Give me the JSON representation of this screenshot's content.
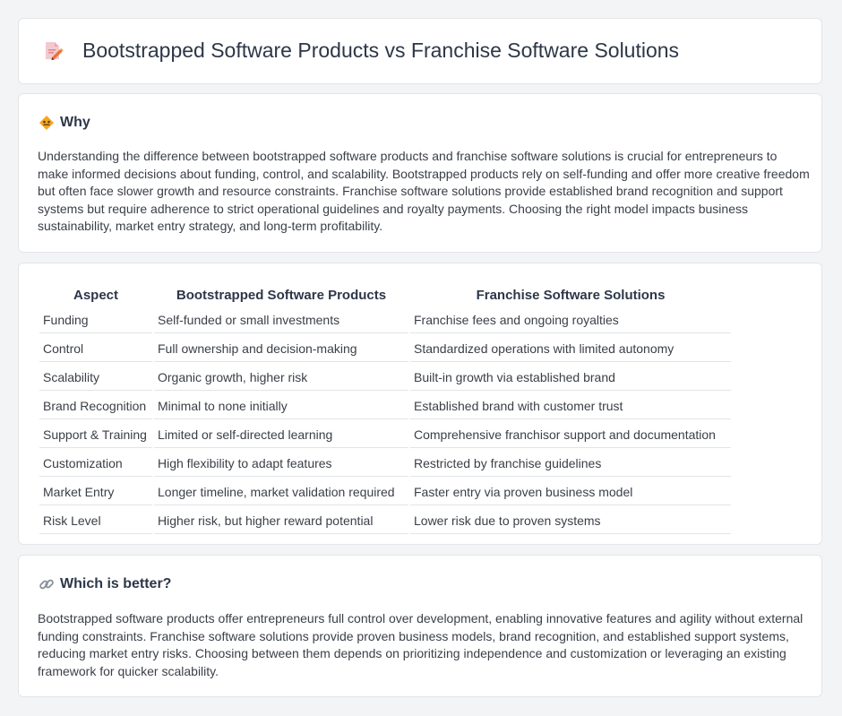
{
  "page": {
    "title": "Bootstrapped Software Products vs Franchise Software Solutions",
    "title_icon": "document-pencil-icon"
  },
  "why": {
    "heading": "Why",
    "icon": "diamond-warning-icon",
    "text": "Understanding the difference between bootstrapped software products and franchise software solutions is crucial for entrepreneurs to make informed decisions about funding, control, and scalability. Bootstrapped products rely on self-funding and offer more creative freedom but often face slower growth and resource constraints. Franchise software solutions provide established brand recognition and support systems but require adherence to strict operational guidelines and royalty payments. Choosing the right model impacts business sustainability, market entry strategy, and long-term profitability."
  },
  "table": {
    "headers": [
      "Aspect",
      "Bootstrapped Software Products",
      "Franchise Software Solutions"
    ],
    "rows": [
      [
        "Funding",
        "Self-funded or small investments",
        "Franchise fees and ongoing royalties"
      ],
      [
        "Control",
        "Full ownership and decision-making",
        "Standardized operations with limited autonomy"
      ],
      [
        "Scalability",
        "Organic growth, higher risk",
        "Built-in growth via established brand"
      ],
      [
        "Brand Recognition",
        "Minimal to none initially",
        "Established brand with customer trust"
      ],
      [
        "Support & Training",
        "Limited or self-directed learning",
        "Comprehensive franchisor support and documentation"
      ],
      [
        "Customization",
        "High flexibility to adapt features",
        "Restricted by franchise guidelines"
      ],
      [
        "Market Entry",
        "Longer timeline, market validation required",
        "Faster entry via proven business model"
      ],
      [
        "Risk Level",
        "Higher risk, but higher reward potential",
        "Lower risk due to proven systems"
      ]
    ]
  },
  "better": {
    "heading": "Which is better?",
    "icon": "link-icon",
    "text": "Bootstrapped software products offer entrepreneurs full control over development, enabling innovative features and agility without external funding constraints. Franchise software solutions provide proven business models, brand recognition, and established support systems, reducing market entry risks. Choosing between them depends on prioritizing independence and customization or leveraging an existing framework for quicker scalability."
  }
}
